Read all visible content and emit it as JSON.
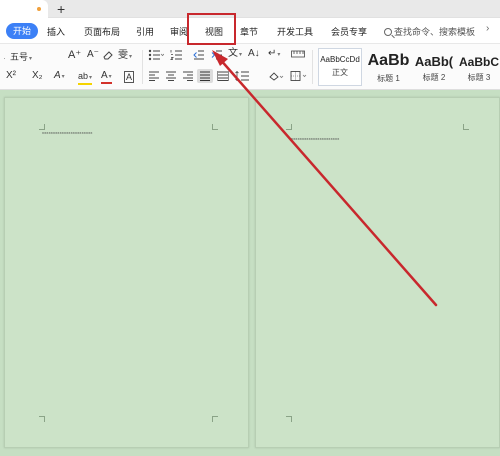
{
  "tabs": {
    "new_tab_glyph": "+"
  },
  "menu": {
    "start": "开始",
    "items": [
      "插入",
      "页面布局",
      "引用",
      "审阅",
      "视图",
      "章节",
      "开发工具",
      "会员专享"
    ],
    "search_placeholder": "查找命令、搜索模板",
    "more": "›"
  },
  "ribbon": {
    "font_size": "五号",
    "font_grow": "A⁺",
    "font_shrink": "A⁻",
    "clear_format_icon": "eraser-icon",
    "phonetic": "雯",
    "superscript": "X²",
    "subscript": "X₂",
    "text_effect": "A",
    "highlight": "ab",
    "font_color": "A",
    "char_border": "A",
    "bullets_icon": "bullet-list-icon",
    "numbering_icon": "numbered-list-icon",
    "outdent_icon": "outdent-icon",
    "indent_icon": "indent-icon",
    "chinese_layout": "文",
    "sort": "A↓",
    "show_marks": "↵",
    "ruler_icon": "ruler-icon",
    "align_left_icon": "align-left-icon",
    "align_center_icon": "align-center-icon",
    "align_right_icon": "align-right-icon",
    "justify_icon": "justify-icon",
    "distribute_icon": "distribute-icon",
    "line_spacing_icon": "line-spacing-icon",
    "shading_icon": "shading-icon",
    "borders_icon": "borders-icon",
    "styles": [
      {
        "preview": "AaBbCcDd",
        "name": "正文"
      },
      {
        "preview": "AaBb",
        "name": "标题 1"
      },
      {
        "preview": "AaBb(",
        "name": "标题 2"
      },
      {
        "preview": "AaBbC",
        "name": "标题 3"
      }
    ]
  },
  "document": {
    "left_page_text": "xxxxxxxxxxxxxxxxxxxxxxx",
    "right_page_text": "xxxxxxxxxxxxxxxxxxxxxx"
  },
  "colors": {
    "accent": "#3c80f6",
    "annotation": "#c8282d",
    "page_background": "#cce3c8"
  }
}
